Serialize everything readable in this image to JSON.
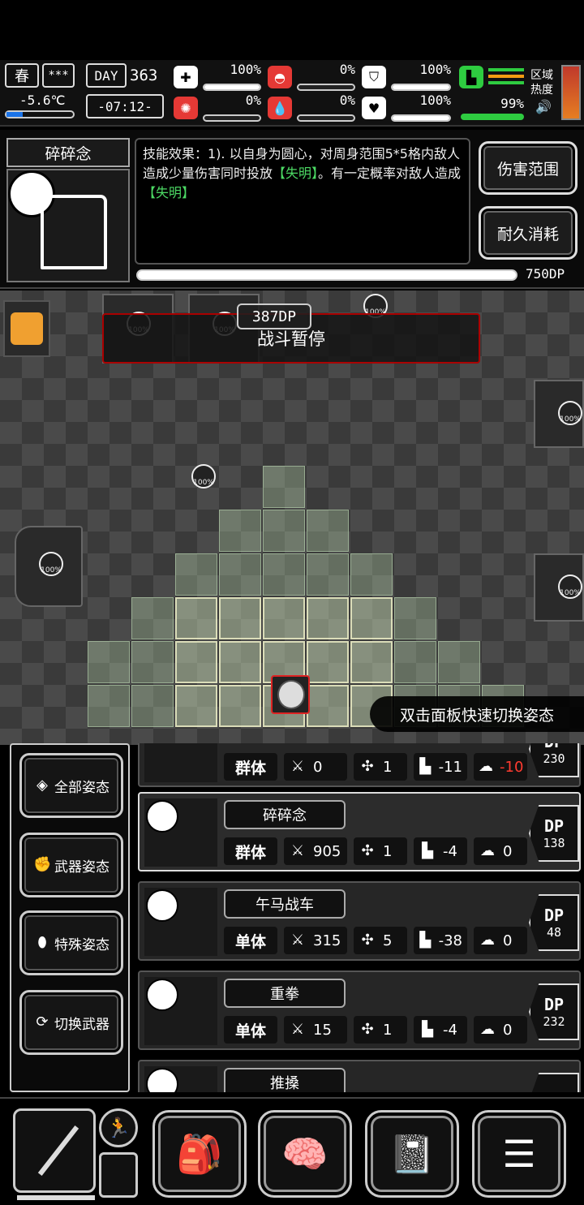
{
  "status": {
    "season": "春",
    "weather": "***",
    "day_label": "DAY",
    "day": "363",
    "temperature": "-5.6℃",
    "time": "-07:12-",
    "stats": [
      {
        "name": "health",
        "icon": "medkit-icon",
        "value": "100%",
        "level": 1.0
      },
      {
        "name": "hunger",
        "icon": "stomach-icon",
        "value": "0%",
        "level": 0.0
      },
      {
        "name": "armor",
        "icon": "shield-icon",
        "value": "100%",
        "level": 1.0
      },
      {
        "name": "infection",
        "icon": "virus-icon",
        "value": "0%",
        "level": 0.0
      },
      {
        "name": "bleeding",
        "icon": "blood-drop-icon",
        "value": "0%",
        "level": 0.0
      },
      {
        "name": "mood",
        "icon": "heart-icon",
        "value": "100%",
        "level": 1.0
      },
      {
        "name": "stamina",
        "icon": "boot-icon",
        "value": "99%",
        "level": 0.99
      }
    ],
    "area_heat_label": "区域热度"
  },
  "skill_panel": {
    "name": "碎碎念",
    "desc_prefix": "技能效果：1). 以自身为圆心，对周身范围5*5格内敌人造成少量伤害同时投放",
    "keyword": "【失明】",
    "desc_mid": "。有一定概率对敌人造成",
    "keyword2": "【失明】",
    "btn_range": "伤害范围",
    "btn_durability": "耐久消耗",
    "dp_total": "750DP",
    "dp_level": 1.0
  },
  "map": {
    "banner": "战斗暂停",
    "dp_float": "387DP",
    "pct": "100%",
    "tip": "双击面板快速切换姿态"
  },
  "stance_menu": [
    {
      "label": "全部姿态",
      "icon": "layers-icon"
    },
    {
      "label": "武器姿态",
      "icon": "fist-icon"
    },
    {
      "label": "特殊姿态",
      "icon": "grenade-icon"
    },
    {
      "label": "切换武器",
      "icon": "swap-icon"
    }
  ],
  "skills": [
    {
      "name": "",
      "type": "群体",
      "atk": "0",
      "hit": "1",
      "dur": "-11",
      "san": "-10",
      "dp": "230"
    },
    {
      "name": "碎碎念",
      "type": "群体",
      "atk": "905",
      "hit": "1",
      "dur": "-4",
      "san": "0",
      "dp": "138"
    },
    {
      "name": "午马战车",
      "type": "单体",
      "atk": "315",
      "hit": "5",
      "dur": "-38",
      "san": "0",
      "dp": "48"
    },
    {
      "name": "重拳",
      "type": "单体",
      "atk": "15",
      "hit": "1",
      "dur": "-4",
      "san": "0",
      "dp": "232"
    },
    {
      "name": "推搡",
      "type": "",
      "atk": "",
      "hit": "",
      "dur": "",
      "san": "",
      "dp": ""
    }
  ],
  "dp_label": "DP",
  "bottom_nav": [
    {
      "name": "weapon",
      "icon": "sword-icon"
    },
    {
      "name": "inventory",
      "icon": "backpack-icon"
    },
    {
      "name": "skills",
      "icon": "brain-icon"
    },
    {
      "name": "journal",
      "icon": "notebook-icon"
    },
    {
      "name": "menu",
      "icon": "list-icon"
    }
  ],
  "colors": {
    "keyword": "#4cd964",
    "danger": "#ff3b30",
    "stamina": "#2ecc40"
  }
}
